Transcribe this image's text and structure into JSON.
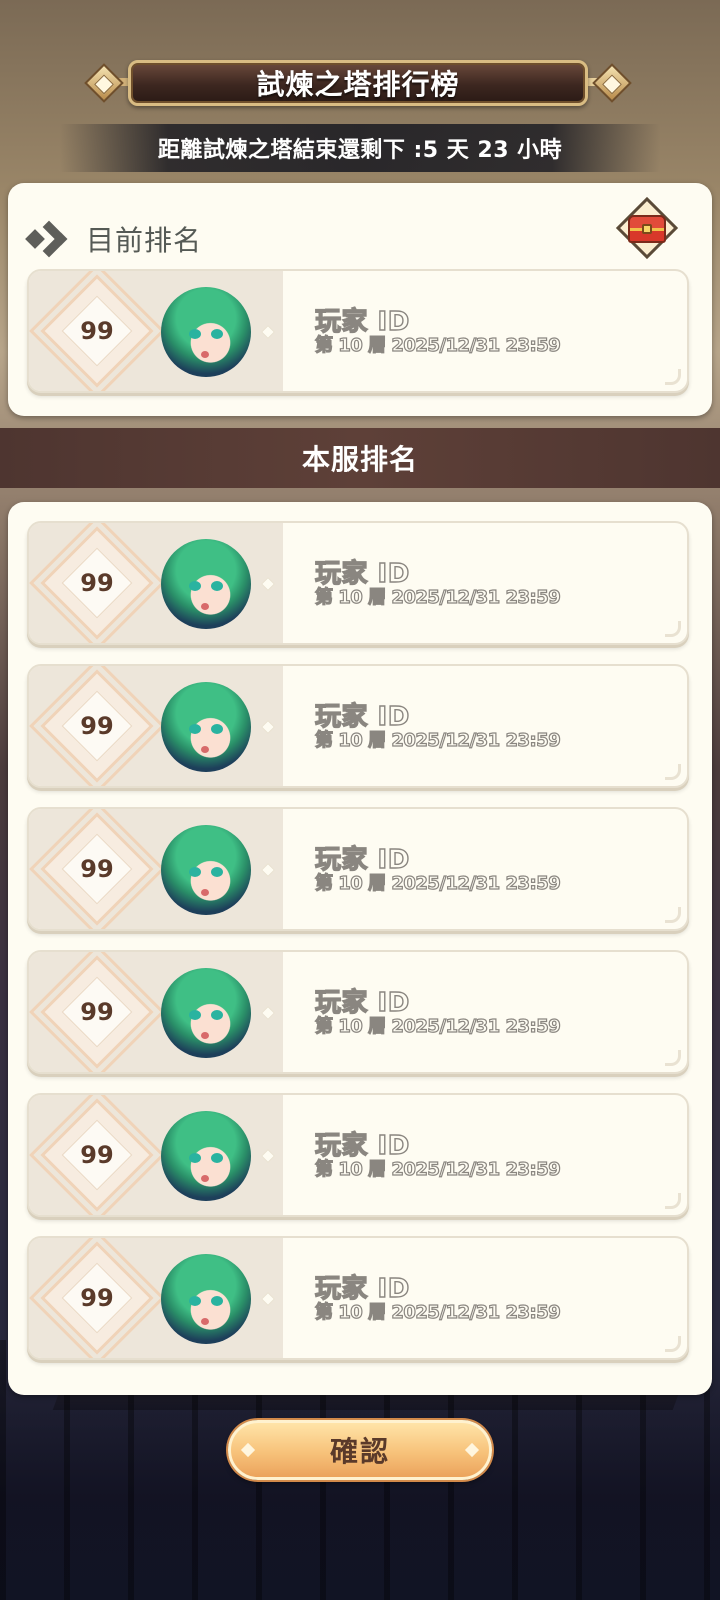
{
  "header": {
    "title": "試煉之塔排行榜",
    "countdown": "距離試煉之塔結束還剩下 :5 天 23 小時"
  },
  "current_rank": {
    "label": "目前排名",
    "entry": {
      "rank": "99",
      "name": "玩家 ID",
      "info": "第 10 層 2025/12/31 23:59"
    }
  },
  "server_rank": {
    "label": "本服排名",
    "entries": [
      {
        "rank": "99",
        "name": "玩家 ID",
        "info": "第 10 層 2025/12/31 23:59"
      },
      {
        "rank": "99",
        "name": "玩家 ID",
        "info": "第 10 層 2025/12/31 23:59"
      },
      {
        "rank": "99",
        "name": "玩家 ID",
        "info": "第 10 層 2025/12/31 23:59"
      },
      {
        "rank": "99",
        "name": "玩家 ID",
        "info": "第 10 層 2025/12/31 23:59"
      },
      {
        "rank": "99",
        "name": "玩家 ID",
        "info": "第 10 層 2025/12/31 23:59"
      },
      {
        "rank": "99",
        "name": "玩家 ID",
        "info": "第 10 層 2025/12/31 23:59"
      }
    ]
  },
  "footer": {
    "confirm_label": "確認"
  },
  "icons": {
    "chest": "treasure-chest-icon",
    "arrow": "chevron-right-icon"
  }
}
